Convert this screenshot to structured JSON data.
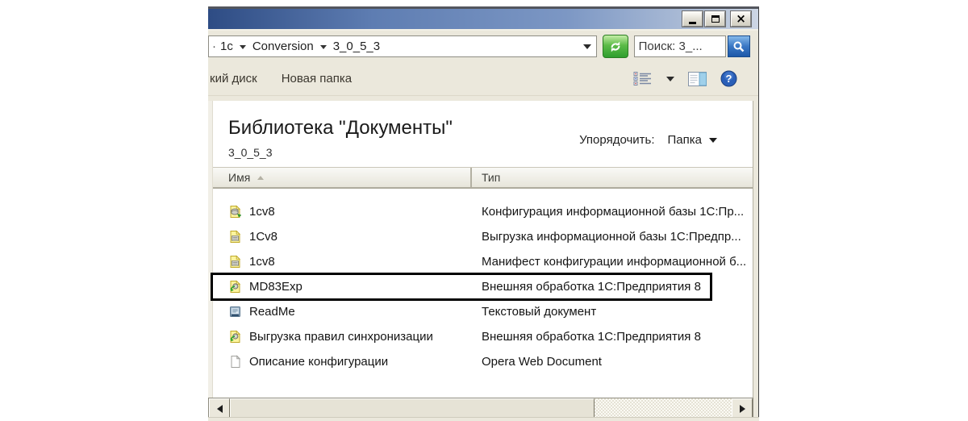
{
  "address_bar": {
    "breadcrumb_prefix": "·",
    "breadcrumb_segments": [
      "1c",
      "Conversion",
      "3_0_5_3"
    ],
    "search_text": "Поиск: 3_..."
  },
  "toolbar": {
    "item_burn_disc": "кий диск",
    "item_new_folder": "Новая папка"
  },
  "library": {
    "title": "Библиотека \"Документы\"",
    "subtitle": "3_0_5_3",
    "arrange_label": "Упорядочить:",
    "arrange_value": "Папка"
  },
  "table": {
    "col_name": "Имя",
    "col_type": "Тип",
    "rows": [
      {
        "icon": "1c-config-file-icon",
        "name": "1cv8",
        "type": "Конфигурация информационной базы 1С:Пр...",
        "highlighted": false
      },
      {
        "icon": "1c-dump-file-icon",
        "name": "1Cv8",
        "type": "Выгрузка информационной базы 1С:Предпр...",
        "highlighted": false
      },
      {
        "icon": "1c-dump-file-icon",
        "name": "1cv8",
        "type": "Манифест конфигурации информационной б...",
        "highlighted": false
      },
      {
        "icon": "1c-external-processing-file-icon",
        "name": "MD83Exp",
        "type": "Внешняя обработка 1С:Предприятия 8",
        "highlighted": true
      },
      {
        "icon": "text-document-file-icon",
        "name": "ReadMe",
        "type": "Текстовый документ",
        "highlighted": false
      },
      {
        "icon": "1c-external-processing-file-icon",
        "name": "Выгрузка правил синхронизации",
        "type": "Внешняя обработка 1С:Предприятия 8",
        "highlighted": false
      },
      {
        "icon": "plain-document-file-icon",
        "name": "Описание конфигурации",
        "type": "Opera Web Document",
        "highlighted": false
      }
    ]
  }
}
